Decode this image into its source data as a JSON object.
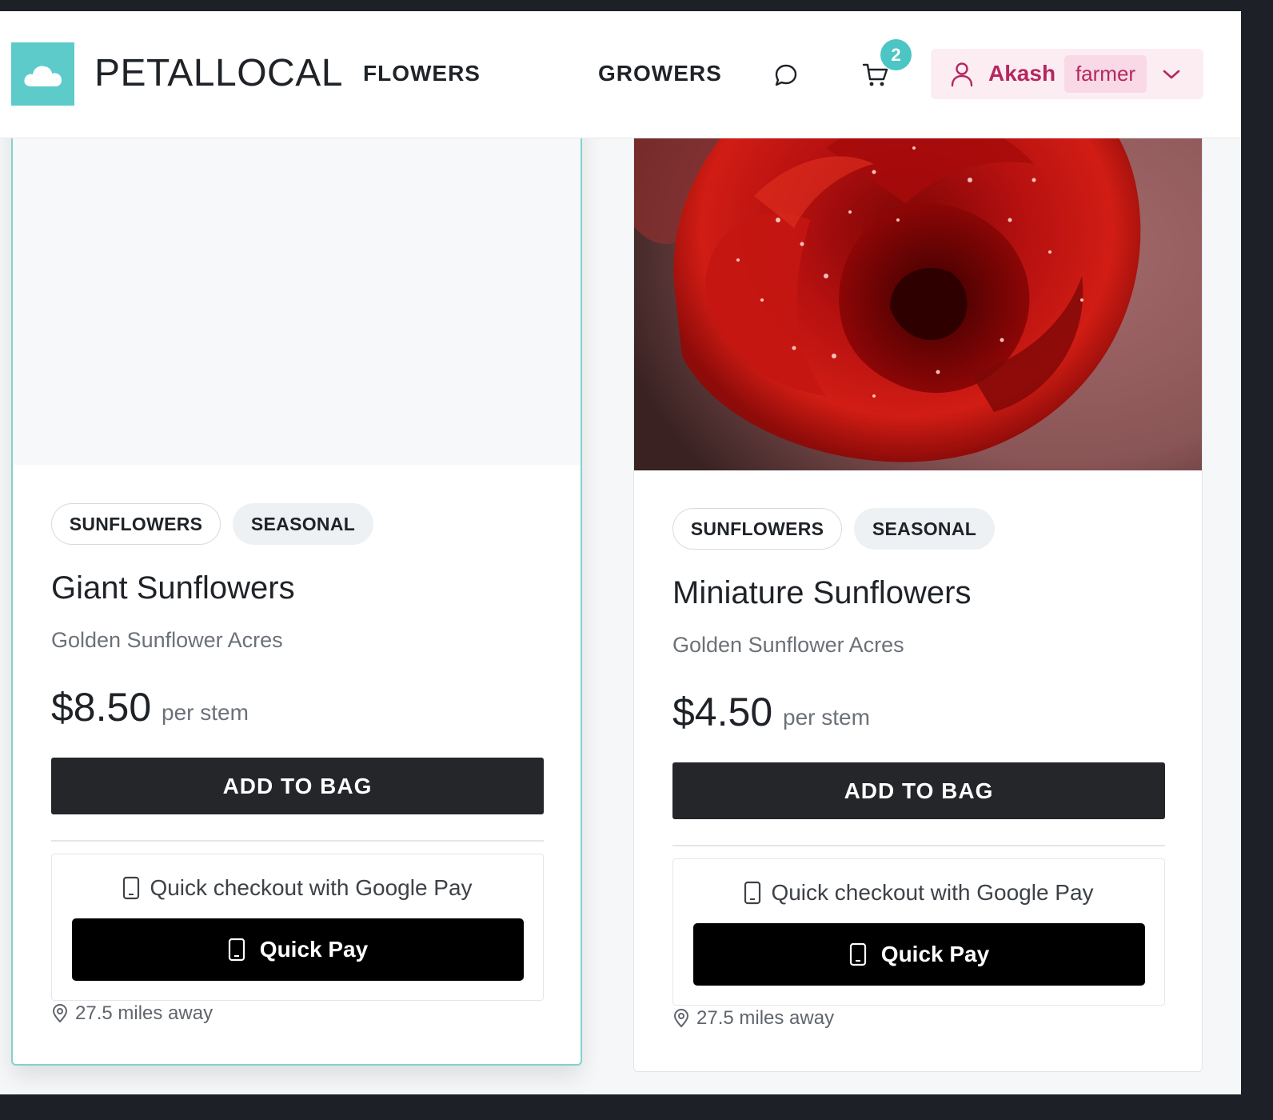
{
  "header": {
    "brand": "PETALLOCAL",
    "nav": {
      "flowers": "FLOWERS",
      "growers": "GROWERS"
    },
    "cart_count": "2",
    "user": {
      "name": "Akash",
      "role": "farmer"
    },
    "colors": {
      "logo_bg": "#5ccbca",
      "badge_bg": "#4cc6c4",
      "user_accent": "#b4285e",
      "user_menu_bg": "#fcedf3"
    }
  },
  "products": [
    {
      "tags": [
        "SUNFLOWERS",
        "SEASONAL"
      ],
      "name": "Giant Sunflowers",
      "grower": "Golden Sunflower Acres",
      "price": "$8.50",
      "unit": "per stem",
      "add_label": "ADD TO BAG",
      "gpay_label": "Quick checkout with Google Pay",
      "quick_pay_label": "Quick Pay",
      "distance": "27.5 miles away",
      "image": "blank-placeholder"
    },
    {
      "tags": [
        "SUNFLOWERS",
        "SEASONAL"
      ],
      "name": "Miniature Sunflowers",
      "grower": "Golden Sunflower Acres",
      "price": "$4.50",
      "unit": "per stem",
      "add_label": "ADD TO BAG",
      "gpay_label": "Quick checkout with Google Pay",
      "quick_pay_label": "Quick Pay",
      "distance": "27.5 miles away",
      "image": "red-rose-photo"
    }
  ]
}
